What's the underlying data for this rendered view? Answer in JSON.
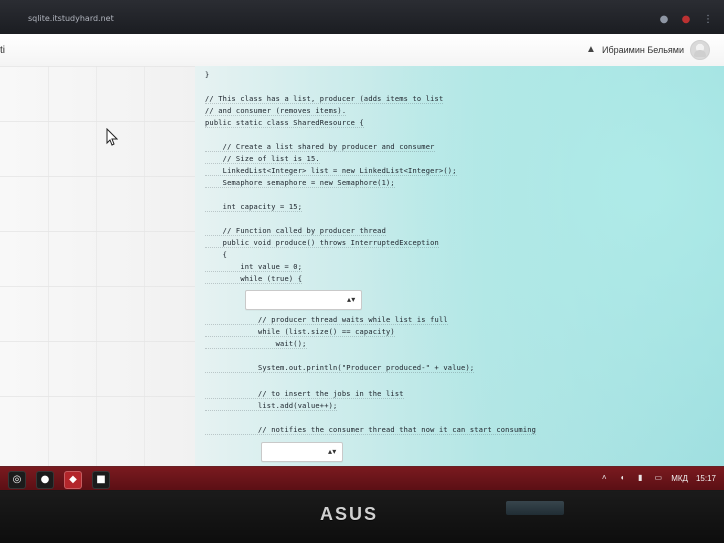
{
  "browser": {
    "url": "sqlite.itstudyhard.net"
  },
  "app": {
    "left_label": "ti",
    "user_name": "Ибраимин Бельями"
  },
  "code": {
    "lines": [
      "}",
      "",
      "// This class has a list, producer (adds items to list",
      "// and consumer (removes items).",
      "public static class SharedResource {",
      "",
      "    // Create a list shared by producer and consumer",
      "    // Size of list is 15.",
      "    LinkedList<Integer> list = new LinkedList<Integer>();",
      "    Semaphore semaphore = new Semaphore(1);",
      "",
      "    int capacity = 15;",
      "",
      "    // Function called by producer thread",
      "    public void produce() throws InterruptedException",
      "    {",
      "        int value = 0;",
      "        while (true) {",
      "",
      "",
      "            // producer thread waits while list is full",
      "            while (list.size() == capacity)",
      "                wait();",
      "",
      "            System.out.println(\"Producer produced-\" + value);",
      "",
      "            // to insert the jobs in the list",
      "            list.add(value++);",
      "",
      "            // notifies the consumer thread that now it can start consuming"
    ]
  },
  "taskbar": {
    "lang": "МКД",
    "time": "15:17"
  },
  "bezel": {
    "brand": "ASUS"
  }
}
